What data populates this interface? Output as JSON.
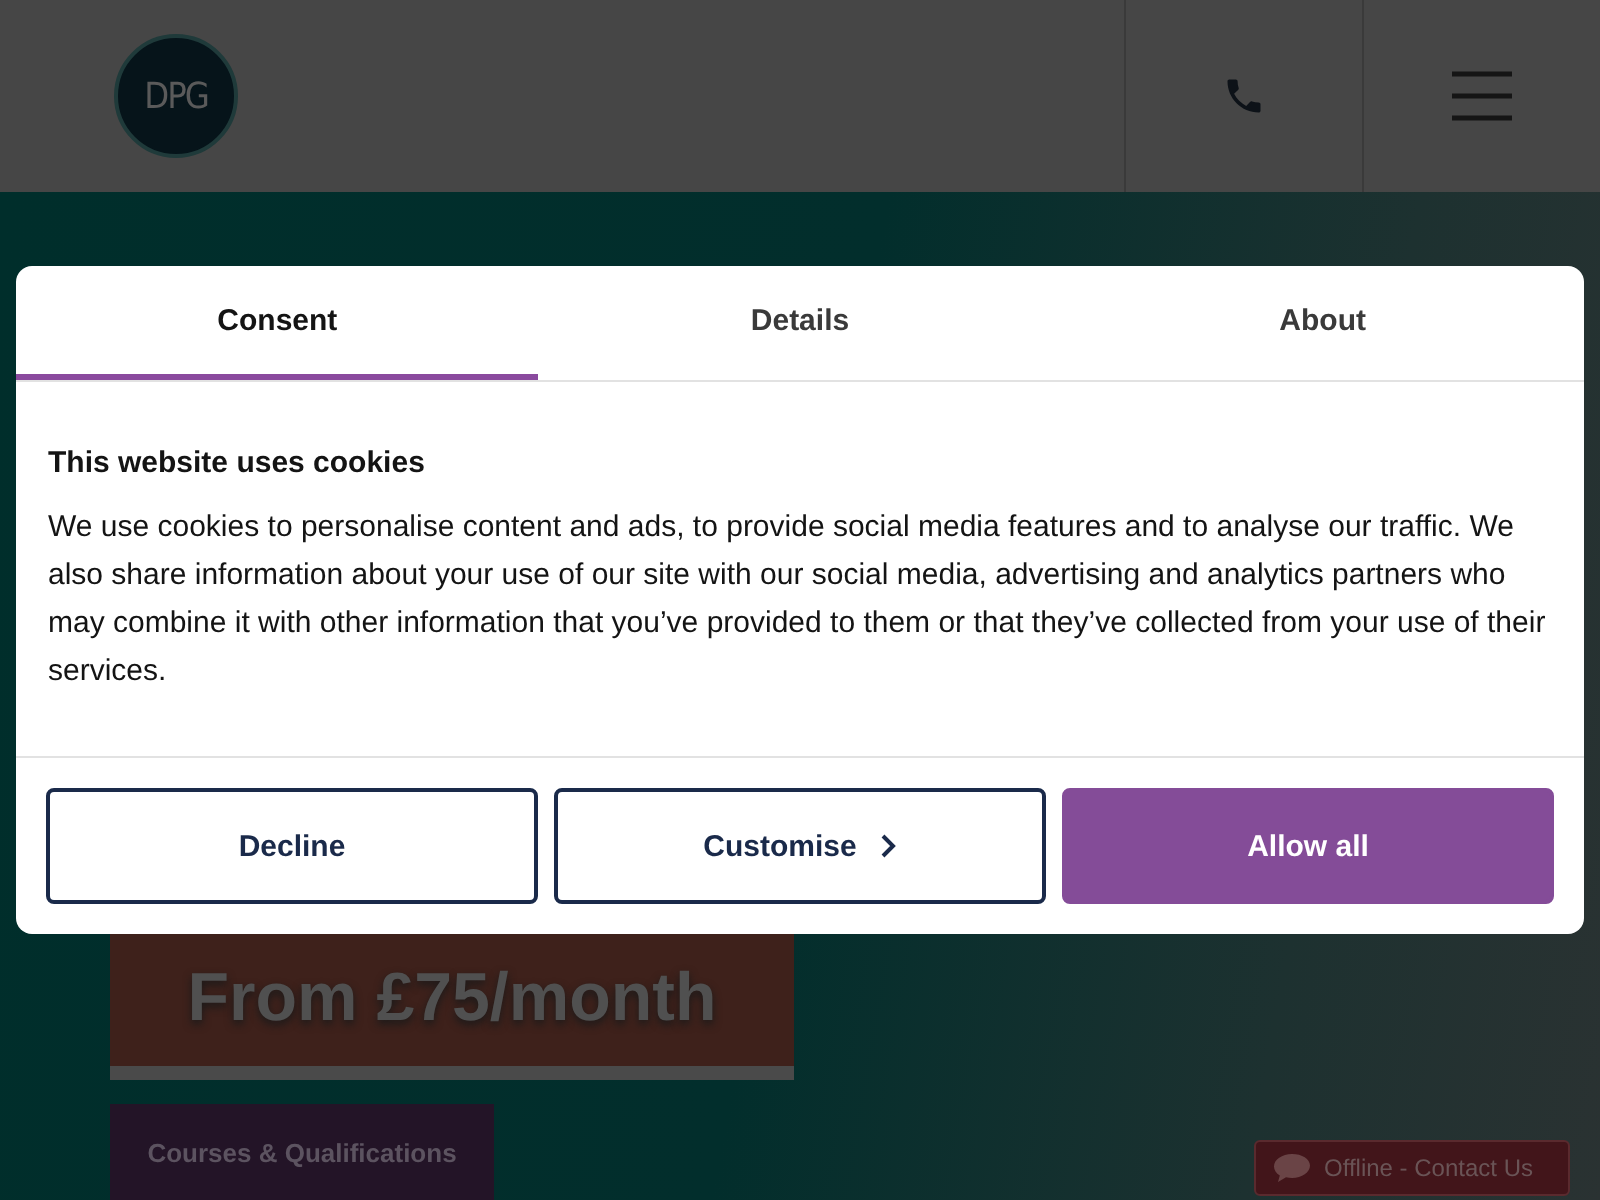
{
  "header": {
    "logo": "DPG"
  },
  "hero": {
    "headline": "From £75/month",
    "cta": "Courses & Qualifications"
  },
  "cookie_dialog": {
    "tabs": [
      {
        "label": "Consent",
        "selected": true
      },
      {
        "label": "Details",
        "selected": false
      },
      {
        "label": "About",
        "selected": false
      }
    ],
    "title": "This website uses cookies",
    "body": "We use cookies to personalise content and ads, to provide social media features and to analyse our traffic. We also share information about your use of our site with our social media, advertising and analytics partners who may combine it with other information that you’ve provided to them or that they’ve collected from your use of their services.",
    "buttons": [
      {
        "label": "Decline",
        "kind": "outline"
      },
      {
        "label": "Customise",
        "kind": "chevron"
      },
      {
        "label": "Allow all",
        "kind": "primary"
      }
    ]
  },
  "chat": {
    "label": "Offline - Contact Us"
  }
}
